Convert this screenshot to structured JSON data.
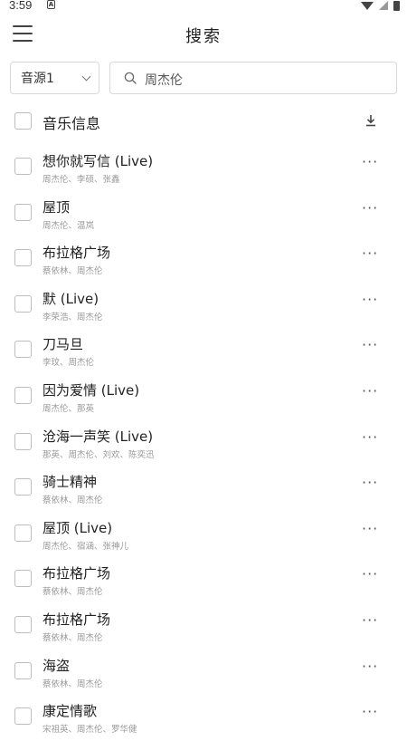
{
  "status_bar": {
    "time": "3:59",
    "icons": [
      "a-notification-icon",
      "wifi-icon",
      "signal-icon",
      "battery-icon"
    ]
  },
  "header": {
    "title": "搜索",
    "menu_icon": "hamburger-menu-icon"
  },
  "search": {
    "source_selected": "音源1",
    "query": "周杰伦",
    "search_icon": "search-icon"
  },
  "list_header": {
    "label": "音乐信息",
    "download_icon": "download-icon"
  },
  "songs": [
    {
      "title": "想你就写信 (Live)",
      "artist": "周杰伦、李硕、张鑫"
    },
    {
      "title": "屋顶",
      "artist": "周杰伦、温岚"
    },
    {
      "title": "布拉格广场",
      "artist": "蔡依林、周杰伦"
    },
    {
      "title": "默 (Live)",
      "artist": "李荣浩、周杰伦"
    },
    {
      "title": "刀马旦",
      "artist": "李玟、周杰伦"
    },
    {
      "title": "因为爱情 (Live)",
      "artist": "周杰伦、那英"
    },
    {
      "title": "沧海一声笑 (Live)",
      "artist": "那英、周杰伦、刘欢、陈奕迅"
    },
    {
      "title": "骑士精神",
      "artist": "蔡依林、周杰伦"
    },
    {
      "title": "屋顶 (Live)",
      "artist": "周杰伦、宿涵、张神儿"
    },
    {
      "title": "布拉格广场",
      "artist": "蔡依林、周杰伦"
    },
    {
      "title": "布拉格广场",
      "artist": "蔡依林、周杰伦"
    },
    {
      "title": "海盗",
      "artist": "蔡依林、周杰伦"
    },
    {
      "title": "康定情歌",
      "artist": "宋祖英、周杰伦、罗华健"
    }
  ],
  "more_label": "···"
}
